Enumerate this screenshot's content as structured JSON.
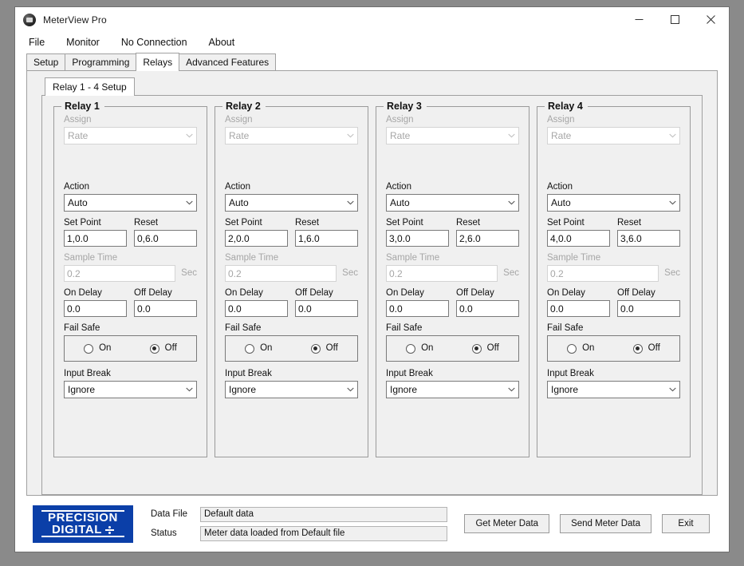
{
  "window": {
    "title": "MeterView Pro",
    "icon": "app-circle-icon",
    "controls": {
      "minimize": "minimize-icon",
      "maximize": "maximize-icon",
      "close": "close-icon"
    }
  },
  "menu": {
    "items": [
      {
        "label": "File"
      },
      {
        "label": "Monitor"
      },
      {
        "label": "No Connection"
      },
      {
        "label": "About"
      }
    ]
  },
  "tabs": {
    "items": [
      {
        "label": "Setup",
        "active": false
      },
      {
        "label": "Programming",
        "active": false
      },
      {
        "label": "Relays",
        "active": true
      },
      {
        "label": "Advanced Features",
        "active": false
      }
    ]
  },
  "inner_tabs": {
    "items": [
      {
        "label": "Relay 1 - 4 Setup",
        "active": true
      }
    ]
  },
  "labels": {
    "assign": "Assign",
    "action": "Action",
    "set_point": "Set Point",
    "reset": "Reset",
    "sample_time": "Sample Time",
    "sec": "Sec",
    "on_delay": "On Delay",
    "off_delay": "Off Delay",
    "fail_safe": "Fail Safe",
    "input_break": "Input Break",
    "radio_on": "On",
    "radio_off": "Off"
  },
  "relays": [
    {
      "title": "Relay 1",
      "assign": "Rate",
      "action": "Auto",
      "set_point": "1,0.0",
      "reset": "0,6.0",
      "sample_time": "0.2",
      "on_delay": "0.0",
      "off_delay": "0.0",
      "fail_safe": "Off",
      "input_break": "Ignore"
    },
    {
      "title": "Relay 2",
      "assign": "Rate",
      "action": "Auto",
      "set_point": "2,0.0",
      "reset": "1,6.0",
      "sample_time": "0.2",
      "on_delay": "0.0",
      "off_delay": "0.0",
      "fail_safe": "Off",
      "input_break": "Ignore"
    },
    {
      "title": "Relay 3",
      "assign": "Rate",
      "action": "Auto",
      "set_point": "3,0.0",
      "reset": "2,6.0",
      "sample_time": "0.2",
      "on_delay": "0.0",
      "off_delay": "0.0",
      "fail_safe": "Off",
      "input_break": "Ignore"
    },
    {
      "title": "Relay 4",
      "assign": "Rate",
      "action": "Auto",
      "set_point": "4,0.0",
      "reset": "3,6.0",
      "sample_time": "0.2",
      "on_delay": "0.0",
      "off_delay": "0.0",
      "fail_safe": "Off",
      "input_break": "Ignore"
    }
  ],
  "footer": {
    "logo": {
      "line1": "PRECISION",
      "line2": "DIGITAL",
      "color": "#0b3fa8"
    },
    "data_file_label": "Data File",
    "data_file_value": "Default data",
    "status_label": "Status",
    "status_value": "Meter data loaded from Default file",
    "buttons": [
      {
        "label": "Get Meter Data"
      },
      {
        "label": "Send Meter Data"
      },
      {
        "label": "Exit"
      }
    ]
  }
}
